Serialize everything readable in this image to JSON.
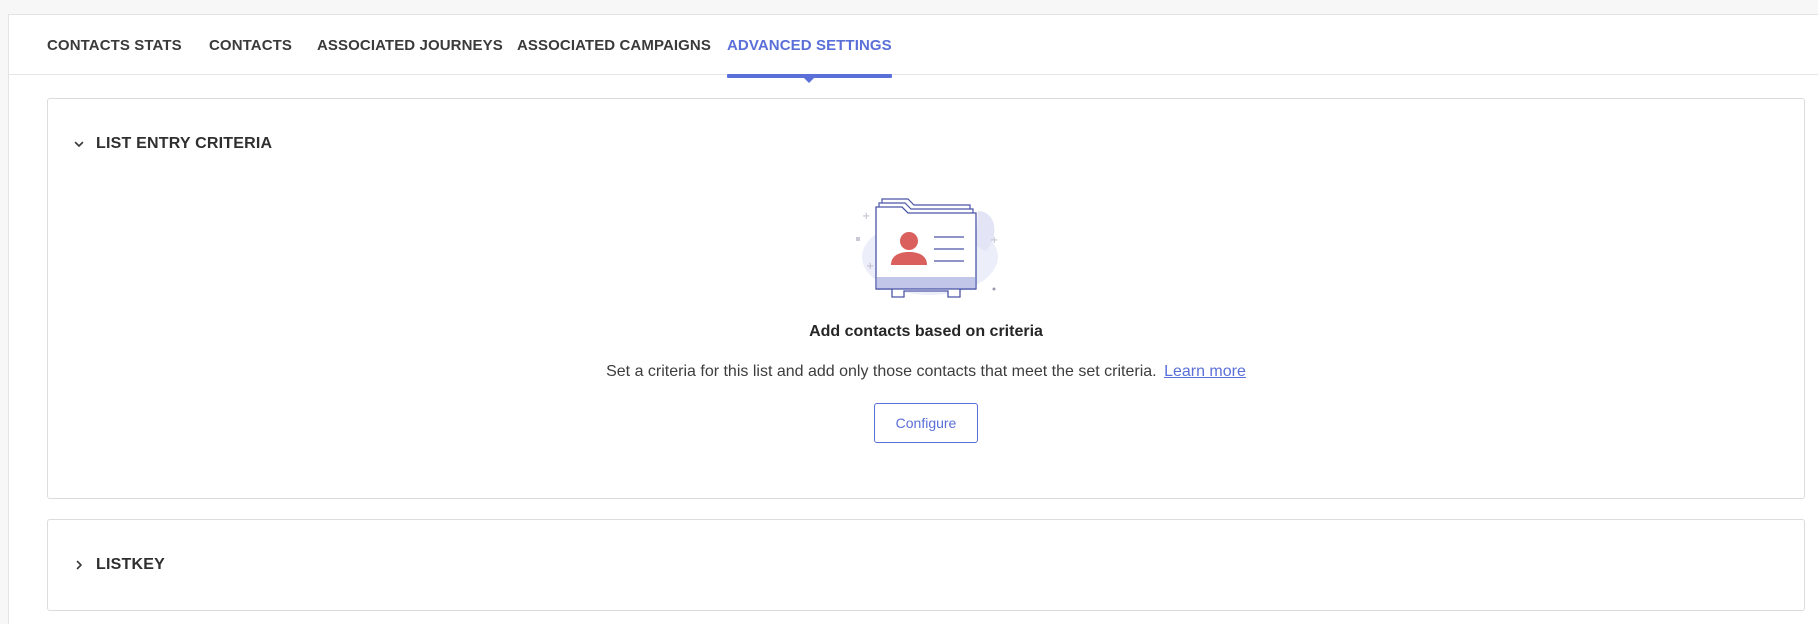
{
  "tabs": [
    {
      "label": "CONTACTS STATS",
      "active": false
    },
    {
      "label": "CONTACTS",
      "active": false
    },
    {
      "label": "ASSOCIATED JOURNEYS",
      "active": false
    },
    {
      "label": "ASSOCIATED CAMPAIGNS",
      "active": false
    },
    {
      "label": "ADVANCED SETTINGS",
      "active": true
    }
  ],
  "sections": {
    "list_entry_criteria": {
      "title": "LIST ENTRY CRITERIA",
      "expanded": true,
      "empty_state": {
        "illustration_icon": "contact-folder-icon",
        "title": "Add contacts based on criteria",
        "description": "Set a criteria for this list and add only those contacts that meet the set criteria.",
        "link_label": "Learn more",
        "button_label": "Configure"
      }
    },
    "listkey": {
      "title": "LISTKEY",
      "expanded": false
    }
  },
  "colors": {
    "accent": "#5b6fd8",
    "avatar": "#d9605c",
    "illustration_fill": "#c2c6e8"
  }
}
